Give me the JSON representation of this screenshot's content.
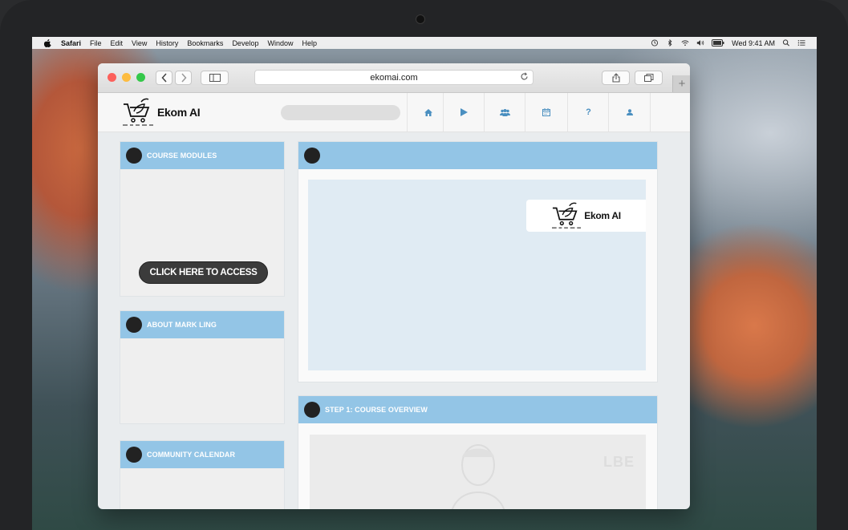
{
  "menubar": {
    "app": "Safari",
    "items": [
      "File",
      "Edit",
      "View",
      "History",
      "Bookmarks",
      "Develop",
      "Window",
      "Help"
    ],
    "clock": "Wed 9:41 AM"
  },
  "browser": {
    "url": "ekomai.com"
  },
  "site": {
    "brand": "Ekom AI",
    "nav": [
      "home-icon",
      "play-icon",
      "users-icon",
      "calendar-icon",
      "?",
      "user-icon"
    ]
  },
  "panels": {
    "course_modules": {
      "title": "COURSE MODULES",
      "button": "CLICK HERE TO ACCESS"
    },
    "about": {
      "title": "ABOUT MARK LING"
    },
    "calendar": {
      "title": "COMMUNITY CALENDAR"
    },
    "main": {
      "title": ""
    },
    "step1": {
      "title": "STEP 1: COURSE OVERVIEW",
      "video_watermark": "LBE"
    }
  },
  "colors": {
    "panel_header": "#93c5e6",
    "nav_icon": "#4a8fc0",
    "button_bg": "#3b3b3b"
  }
}
